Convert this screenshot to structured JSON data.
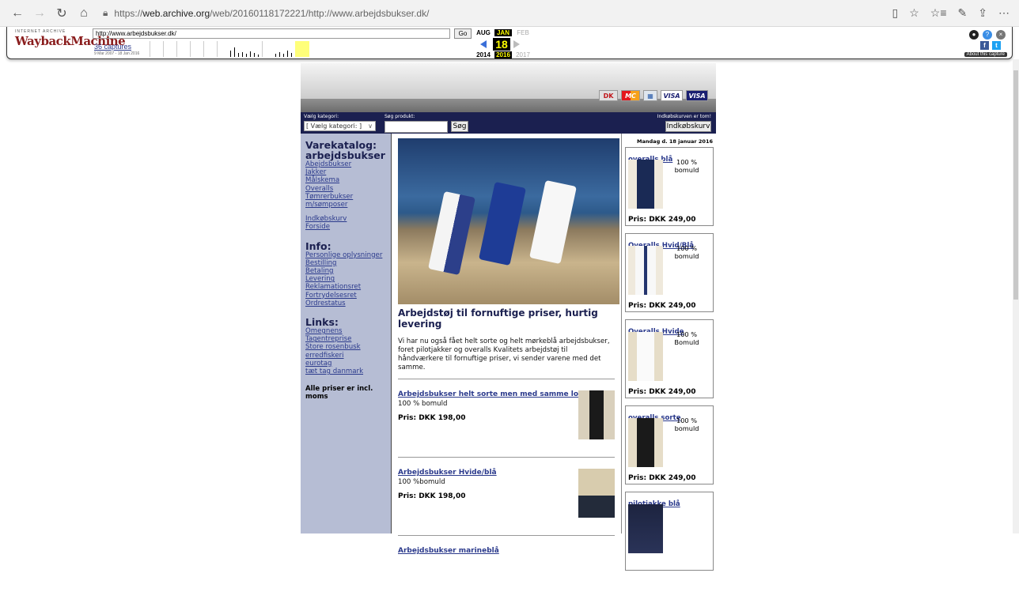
{
  "browser": {
    "url_prefix": "https://",
    "url_host": "web.archive.org",
    "url_path": "/web/20160118172221/http://www.arbejdsbukser.dk/"
  },
  "wayback": {
    "logo_top": "INTERNET ARCHIVE",
    "logo_main": "WaybackMachine",
    "url_value": "http://www.arbejdsbukser.dk/",
    "go_label": "Go",
    "captures": "36 captures",
    "range": "9 Mar 2007 - 18 Jan 2016",
    "months": [
      "AUG",
      "JAN",
      "FEB"
    ],
    "day": "18",
    "years": [
      "2014",
      "2016",
      "2017"
    ],
    "about": "About this capture"
  },
  "site": {
    "category_label": "Vælg kategori:",
    "category_value": "[ Vælg kategori: ]",
    "search_label": "Søg produkt:",
    "search_button": "Søg",
    "cart_status": "Indkøbskurven er tom!",
    "cart_button": "Indkøbskurv",
    "cards": [
      "DK",
      "MC",
      "▦",
      "VISA",
      "VISA"
    ]
  },
  "left": {
    "catalog_title": "Varekatalog: arbejdsbukser",
    "catalog_links": [
      "Abejdsbukser",
      "Jakker",
      "Målskema",
      "Overalls",
      "Tømrerbukser m/sømposer"
    ],
    "misc_links": [
      "Indkøbskurv",
      "Forside"
    ],
    "info_title": "Info:",
    "info_links": [
      "Personlige oplysninger",
      "Bestilling",
      "Betaling",
      "Levering",
      "Reklamationsret",
      "Fortrydelsesret",
      "Ordrestatus"
    ],
    "links_title": "Links:",
    "ext_links": [
      "Omegnens",
      "Tagentreprise",
      "Store rosenbusk",
      "erredfiskeri",
      "eurotag",
      "tæt tag danmark"
    ],
    "note": "Alle priser er incl. moms"
  },
  "main": {
    "headline": "Arbejdstøj til fornuftige priser, hurtig levering",
    "intro": "Vi har nu også fået helt sorte og helt mørkeblå arbejdsbukser, foret pilotjakker og overalls Kvalitets arbejdstøj til håndværkere til fornuftige priser, vi sender varene med det samme.",
    "products": [
      {
        "title": "Arbejdsbukser helt sorte men med samme lommer",
        "desc": "100 % bomuld",
        "price": "Pris: DKK 198,00"
      },
      {
        "title": "Arbejdsbukser Hvide/blå",
        "desc": "100 %bomuld",
        "price": "Pris: DKK 198,00"
      },
      {
        "title": "Arbejdsbukser marineblå",
        "desc": "",
        "price": ""
      }
    ]
  },
  "right": {
    "date": "Mandag d. 18 januar 2016",
    "items": [
      {
        "title": "overalls blå",
        "desc": "100 % bomuld",
        "price": "Pris: DKK 249,00"
      },
      {
        "title": "Overalls Hvid/Blå",
        "desc": "100 % bomuld",
        "price": "Pris: DKK 249,00"
      },
      {
        "title": "Overalls Hvide",
        "desc": "100 % Bomuld",
        "price": "Pris: DKK 249,00"
      },
      {
        "title": "overalls sorte",
        "desc": "100 % bomuld",
        "price": "Pris: DKK 249,00"
      },
      {
        "title": "pilotjakke blå",
        "desc": "",
        "price": ""
      }
    ]
  }
}
